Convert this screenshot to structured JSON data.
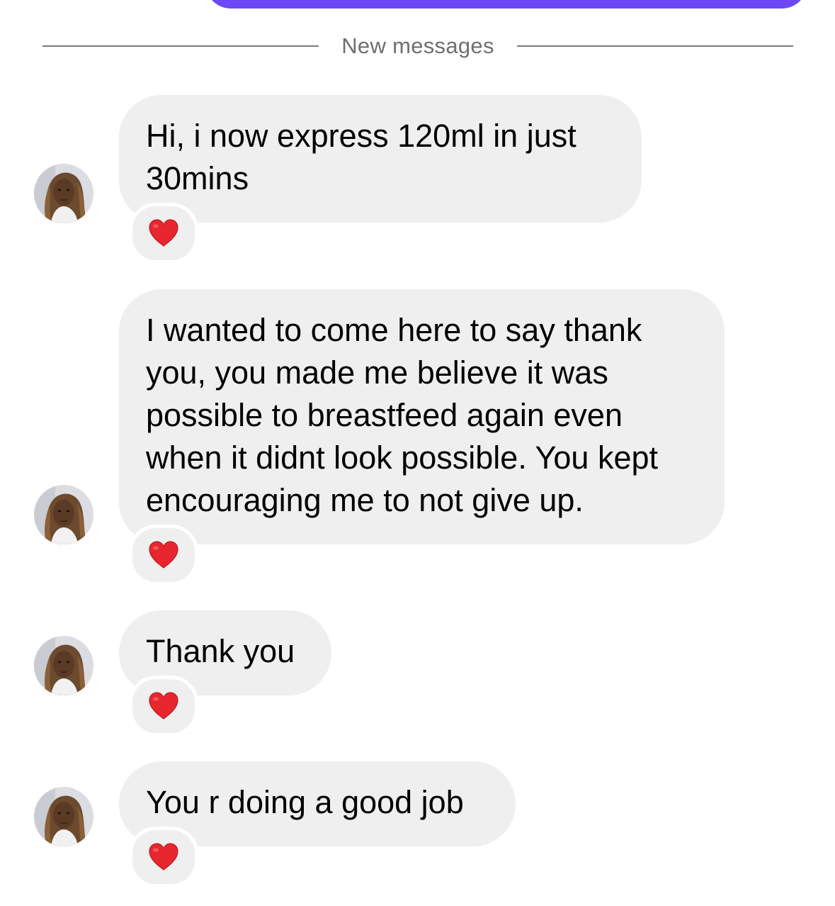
{
  "colors": {
    "sent_bubble": "#6b47f5",
    "received_bubble": "#efefef",
    "divider": "#7a7a7a",
    "divider_text": "#6f6f6f",
    "heart": "#e8262e"
  },
  "divider": {
    "label": "New messages"
  },
  "messages": [
    {
      "text": "Hi, i now express 120ml in just 30mins",
      "reaction": "red-heart"
    },
    {
      "text": "I wanted to come here to say thank you, you made me believe it was possible to breastfeed again even when it didnt look possible. You kept encouraging me to not give up.",
      "reaction": "red-heart"
    },
    {
      "text": "Thank you",
      "reaction": "red-heart"
    },
    {
      "text": "You r doing a good job",
      "reaction": "red-heart"
    }
  ]
}
